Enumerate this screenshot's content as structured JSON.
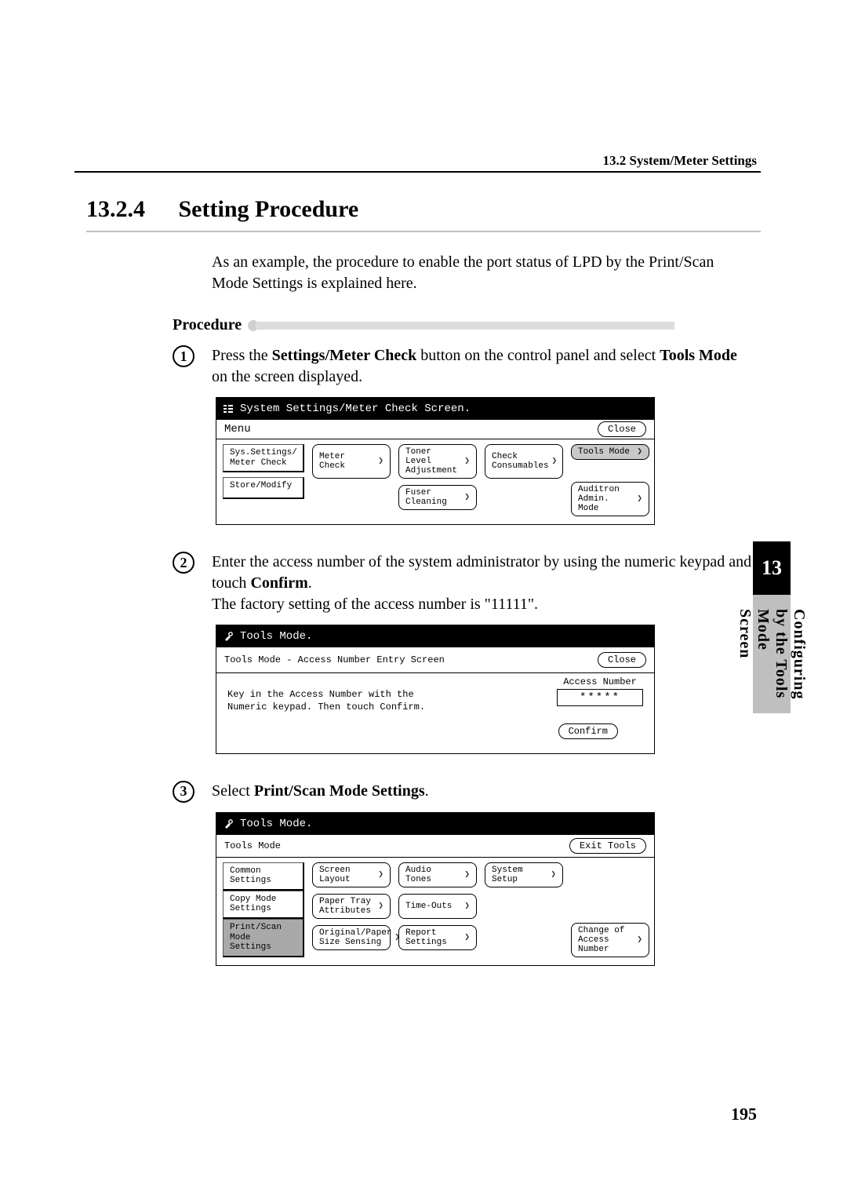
{
  "running_head": "13.2 System/Meter Settings",
  "heading_num": "13.2.4",
  "heading_title": "Setting Procedure",
  "intro": "As an example, the procedure to enable the port status of LPD by the Print/Scan Mode Settings is explained here.",
  "procedure_label": "Procedure",
  "steps": {
    "s1": {
      "num": "1",
      "pre": "Press the ",
      "bold1": "Settings/Meter Check",
      "mid": " button on the control panel and select ",
      "bold2": "Tools Mode",
      "post": " on the screen displayed."
    },
    "s2": {
      "num": "2",
      "line1_pre": "Enter the access number of the system administrator by using the numeric keypad and touch ",
      "line1_bold": "Confirm",
      "line1_post": ".",
      "line2": "The factory setting of the access number is \"11111\"."
    },
    "s3": {
      "num": "3",
      "pre": "Select ",
      "bold": "Print/Scan Mode Settings",
      "post": "."
    }
  },
  "shot1": {
    "title": "System Settings/Meter Check Screen.",
    "menu_label": "Menu",
    "close": "Close",
    "left": {
      "a": "Sys.Settings/\nMeter Check",
      "b": "Store/Modify"
    },
    "grid": {
      "meter_check": "Meter Check",
      "toner": "Toner Level\nAdjustment",
      "consumables": "Check\nConsumables",
      "fuser": "Fuser Cleaning"
    },
    "right": {
      "tools_mode": "Tools Mode",
      "auditron": "Auditron\nAdmin. Mode"
    }
  },
  "shot2": {
    "title": "Tools Mode.",
    "breadcrumb": "Tools Mode - Access Number Entry Screen",
    "close": "Close",
    "instr": "Key in the Access Number with the Numeric keypad. Then touch Confirm.",
    "acc_title": "Access Number",
    "acc_value": "*****",
    "confirm": "Confirm"
  },
  "shot3": {
    "title": "Tools Mode.",
    "row_label": "Tools Mode",
    "exit": "Exit Tools",
    "left": {
      "a": "Common\nSettings",
      "b": "Copy Mode\nSettings",
      "c": "Print/Scan\nMode Settings"
    },
    "grid": {
      "screen_layout": "Screen Layout",
      "audio": "Audio Tones",
      "system_setup": "System Setup",
      "paper_tray": "Paper Tray\nAttributes",
      "timeouts": "Time-Outs",
      "original": "Original/Paper\nSize Sensing",
      "report": "Report\nSettings"
    },
    "right": {
      "change_access": "Change of\nAccess Number"
    }
  },
  "side": {
    "chapter_num": "13",
    "chapter_title": "Configuring by the Tools Mode Screen"
  },
  "footer_page": "195"
}
